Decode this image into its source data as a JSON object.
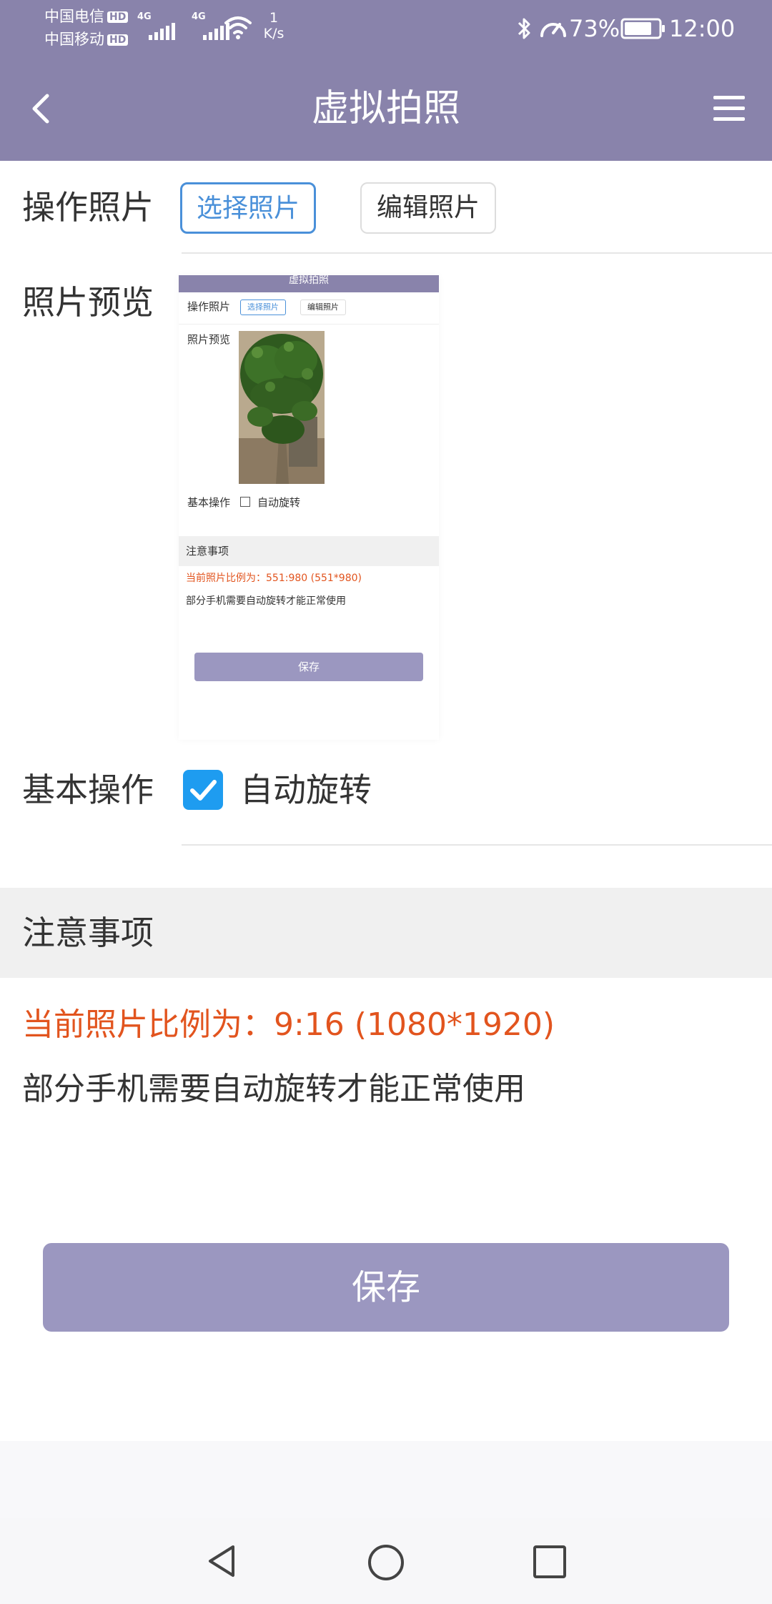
{
  "status_bar": {
    "carrier1": "中国电信",
    "carrier2": "中国移动",
    "hd_tag": "HD",
    "net_tag": "4G",
    "speed_value": "1",
    "speed_unit": "K/s",
    "battery": "73%",
    "time": "12:00"
  },
  "app_bar": {
    "title": "虚拟拍照",
    "back_icon": "back-arrow-icon",
    "menu_icon": "hamburger-menu-icon"
  },
  "photo_ops": {
    "label": "操作照片",
    "select_label": "选择照片",
    "edit_label": "编辑照片"
  },
  "preview": {
    "label": "照片预览",
    "thumbnail": {
      "title": "虚拟拍照",
      "ops_label": "操作照片",
      "select_label": "选择照片",
      "edit_label": "编辑照片",
      "preview_label": "照片预览",
      "basic_label": "基本操作",
      "rotate_label": "自动旋转",
      "notice_title": "注意事项",
      "ratio_text": "当前照片比例为：551:980 (551*980)",
      "tip_text": "部分手机需要自动旋转才能正常使用",
      "save_label": "保存"
    }
  },
  "basic": {
    "label": "基本操作",
    "rotate_label": "自动旋转",
    "rotate_checked": true
  },
  "notice": {
    "title": "注意事项",
    "ratio_text": "当前照片比例为：9:16 (1080*1920)",
    "tip_text": "部分手机需要自动旋转才能正常使用"
  },
  "save_label": "保存",
  "nav": {
    "back": "nav-back-icon",
    "home": "nav-home-icon",
    "recents": "nav-recents-icon"
  },
  "colors": {
    "header": "#8983ab",
    "button": "#9b97c0",
    "accent": "#4a90d9",
    "checkbox": "#1e9cf0",
    "warning": "#e2541e"
  }
}
